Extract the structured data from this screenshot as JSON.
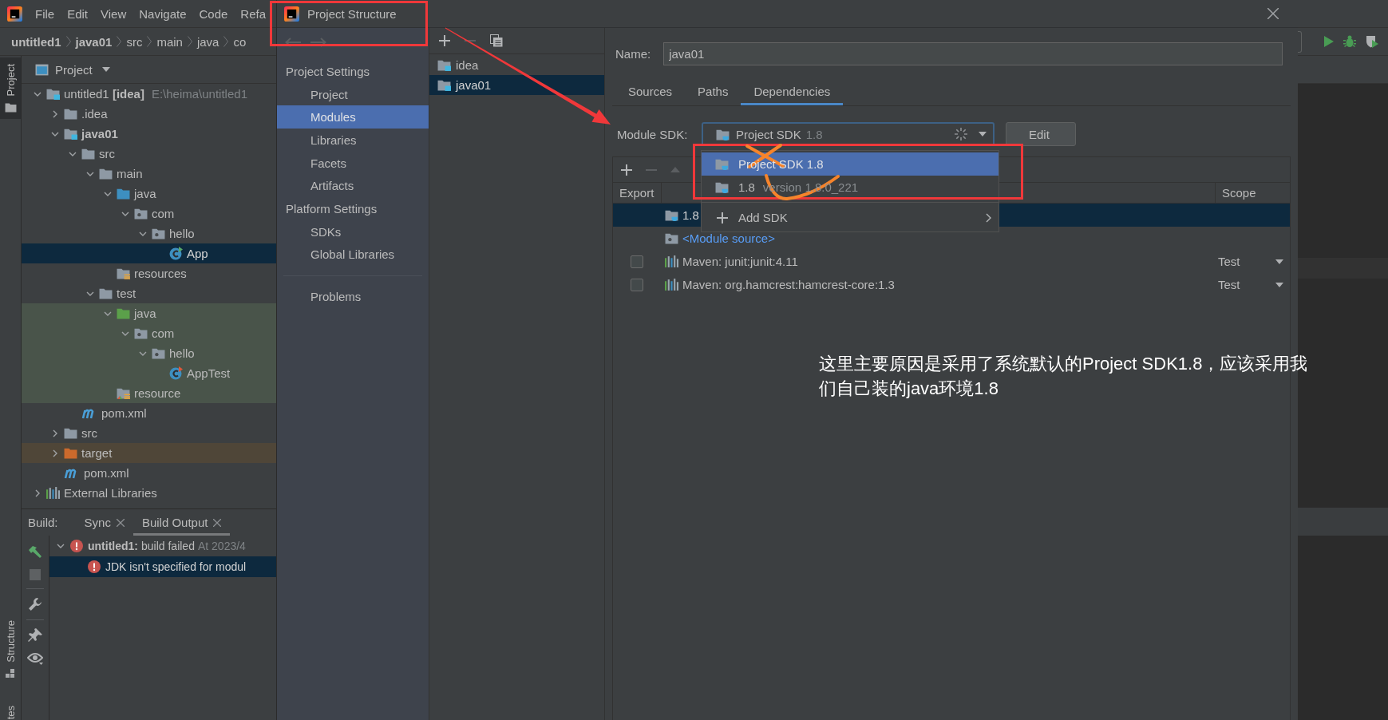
{
  "menu_bar": {
    "items": [
      "File",
      "Edit",
      "View",
      "Navigate",
      "Code",
      "Refa"
    ]
  },
  "breadcrumbs": [
    {
      "label": "untitled1",
      "bold": true
    },
    {
      "label": "java01",
      "bold": true
    },
    {
      "label": "src",
      "bold": false
    },
    {
      "label": "main",
      "bold": false
    },
    {
      "label": "java",
      "bold": false
    },
    {
      "label": "co",
      "bold": false
    }
  ],
  "left_stripe": {
    "top_tabs": [
      {
        "label": "Project",
        "selected": true
      }
    ],
    "bottom_tabs": [
      {
        "label": "Structure",
        "selected": false
      },
      {
        "label": "tes",
        "selected": false
      }
    ]
  },
  "project_panel": {
    "title": "Project",
    "tree": [
      {
        "label": "untitled1 **[idea]**",
        "path": "E:\\heima\\untitled1",
        "kind": "module",
        "expanded": true,
        "selected": false,
        "children": [
          {
            "label": ".idea",
            "kind": "folder",
            "expanded": false,
            "selected": false
          },
          {
            "label": "java01",
            "kind": "module",
            "bold": true,
            "expanded": true,
            "selected": false,
            "children": [
              {
                "label": "src",
                "kind": "folder",
                "expanded": true,
                "selected": false,
                "children": [
                  {
                    "label": "main",
                    "kind": "folder",
                    "expanded": true,
                    "selected": false,
                    "children": [
                      {
                        "label": "java",
                        "kind": "source-root",
                        "expanded": true,
                        "selected": false,
                        "children": [
                          {
                            "label": "com",
                            "kind": "package",
                            "expanded": true,
                            "selected": false,
                            "children": [
                              {
                                "label": "hello",
                                "kind": "package",
                                "expanded": true,
                                "selected": false,
                                "children": [
                                  {
                                    "label": "App",
                                    "kind": "class",
                                    "selected": true
                                  }
                                ]
                              }
                            ]
                          }
                        ]
                      },
                      {
                        "label": "resources",
                        "kind": "resources-root",
                        "selected": false
                      }
                    ]
                  },
                  {
                    "label": "test",
                    "kind": "folder",
                    "expanded": true,
                    "selected": false,
                    "children": [
                      {
                        "label": "java",
                        "kind": "test-root",
                        "expanded": true,
                        "selected": false,
                        "color": "#49544a",
                        "children": [
                          {
                            "label": "com",
                            "kind": "package",
                            "expanded": true,
                            "selected": false,
                            "color": "#49544a",
                            "children": [
                              {
                                "label": "hello",
                                "kind": "package",
                                "expanded": true,
                                "selected": false,
                                "color": "#49544a",
                                "children": [
                                  {
                                    "label": "AppTest",
                                    "kind": "test-class",
                                    "selected": false,
                                    "color": "#49544a"
                                  }
                                ]
                              }
                            ]
                          }
                        ]
                      },
                      {
                        "label": "resource",
                        "kind": "test-resources-root",
                        "selected": false,
                        "color": "#49544a"
                      }
                    ]
                  }
                ]
              },
              {
                "label": "pom.xml",
                "kind": "maven",
                "selected": false
              }
            ]
          },
          {
            "label": "src",
            "kind": "folder",
            "expanded": false,
            "selected": false
          },
          {
            "label": "target",
            "kind": "excluded",
            "expanded": false,
            "selected": false,
            "color": "#4f4638"
          },
          {
            "label": "pom.xml",
            "kind": "maven",
            "selected": false
          }
        ]
      },
      {
        "label": "External Libraries",
        "kind": "library",
        "expanded": false,
        "selected": false
      }
    ]
  },
  "build_panel": {
    "label": "Build:",
    "tabs": [
      {
        "label": "Sync",
        "selected": false
      },
      {
        "label": "Build Output",
        "selected": true
      }
    ],
    "tree": [
      {
        "kind": "error",
        "name": "untitled1:",
        "message": "build failed",
        "time": "At 2023/4",
        "expanded": true,
        "selected": false,
        "children": [
          {
            "kind": "error",
            "message": "JDK isn't specified for modul",
            "selected": true
          }
        ]
      }
    ]
  },
  "dialog": {
    "title": "Project Structure",
    "nav_toolbar": [
      {
        "kind": "back",
        "disabled": true
      },
      {
        "kind": "forward",
        "disabled": true
      }
    ],
    "nav": [
      {
        "kind": "heading",
        "label": "Project Settings"
      },
      {
        "kind": "item",
        "label": "Project",
        "selected": false
      },
      {
        "kind": "item",
        "label": "Modules",
        "selected": true
      },
      {
        "kind": "item",
        "label": "Libraries",
        "selected": false
      },
      {
        "kind": "item",
        "label": "Facets",
        "selected": false
      },
      {
        "kind": "item",
        "label": "Artifacts",
        "selected": false
      },
      {
        "kind": "heading",
        "label": "Platform Settings"
      },
      {
        "kind": "item",
        "label": "SDKs",
        "selected": false
      },
      {
        "kind": "item",
        "label": "Global Libraries",
        "selected": false
      },
      {
        "kind": "separator"
      },
      {
        "kind": "item",
        "label": "Problems",
        "selected": false
      }
    ],
    "modules_toolbar": [
      {
        "kind": "add",
        "disabled": false
      },
      {
        "kind": "remove",
        "disabled": true
      },
      {
        "kind": "copy",
        "disabled": false
      }
    ],
    "modules": [
      {
        "label": "idea",
        "selected": false
      },
      {
        "label": "java01",
        "selected": true
      }
    ],
    "name_field": {
      "label": "Name:",
      "value": "java01"
    },
    "tabs": [
      {
        "label": "Sources",
        "selected": false
      },
      {
        "label": "Paths",
        "selected": false
      },
      {
        "label": "Dependencies",
        "selected": true
      }
    ],
    "module_sdk": {
      "label": "Module SDK:",
      "value": "Project SDK",
      "version": "1.8",
      "loading": true,
      "button": "Edit"
    },
    "sdk_dropdown": {
      "items": [
        {
          "kind": "sdk",
          "label": "Project SDK 1.8",
          "selected": true
        },
        {
          "kind": "sdk",
          "label": "1.8",
          "detail": "version 1.8.0_221",
          "selected": false
        },
        {
          "kind": "add",
          "label": "Add SDK",
          "selected": false
        }
      ]
    },
    "dependencies": {
      "toolbar": [
        {
          "kind": "add",
          "disabled": false
        },
        {
          "kind": "remove",
          "disabled": true
        },
        {
          "kind": "up",
          "disabled": true
        }
      ],
      "columns": [
        "Export",
        "Scope"
      ],
      "rows": [
        {
          "kind": "sdk",
          "label": "1.8",
          "selected": true
        },
        {
          "kind": "source",
          "label": "<Module source>",
          "selected": false
        },
        {
          "kind": "library",
          "label": "Maven: junit:junit:4.11",
          "export": false,
          "scope": "Test",
          "selected": false
        },
        {
          "kind": "library",
          "label": "Maven: org.hamcrest:hamcrest-core:1.3",
          "export": false,
          "scope": "Test",
          "selected": false
        }
      ]
    }
  },
  "annotation": {
    "text": "这里主要原因是采用了系统默认的Project SDK1.8，应该采用我们自己装的java环境1.8"
  }
}
